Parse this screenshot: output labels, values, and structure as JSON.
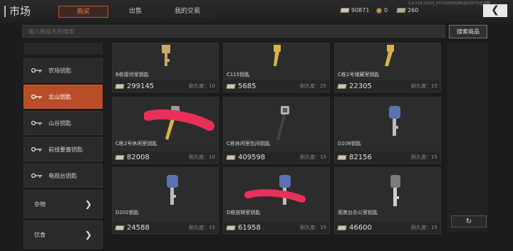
{
  "header": {
    "title": "市场",
    "tabs": [
      {
        "label": "购买",
        "active": true
      },
      {
        "label": "出售",
        "active": false
      },
      {
        "label": "我的交易",
        "active": false
      }
    ],
    "build_info": "1.0.118.11612_071|10525|3819|21073|正式服",
    "currencies": [
      {
        "icon": "cash-icon",
        "value": "90871"
      },
      {
        "icon": "coin-icon",
        "value": "0"
      },
      {
        "icon": "voucher-icon",
        "value": "260"
      }
    ],
    "back_icon": "chevron-left-icon"
  },
  "search": {
    "placeholder": "输入物品名称搜索",
    "button_label": "搜索商品"
  },
  "sidebar": {
    "items": [
      {
        "label": "农场钥匙",
        "active": false,
        "type": "key"
      },
      {
        "label": "北山钥匙",
        "active": true,
        "type": "key"
      },
      {
        "label": "山谷钥匙",
        "active": false,
        "type": "key"
      },
      {
        "label": "前线要塞钥匙",
        "active": false,
        "type": "key"
      },
      {
        "label": "电视台钥匙",
        "active": false,
        "type": "key"
      }
    ],
    "categories": [
      {
        "label": "杂物"
      },
      {
        "label": "饮食"
      }
    ]
  },
  "items": [
    {
      "name": "B栋接待室钥匙",
      "price": "299145",
      "durability": "耐久度：10",
      "key_color": "#c9a56a"
    },
    {
      "name": "C115钥匙",
      "price": "5685",
      "durability": "耐久度：25",
      "key_color": "#d9b24a"
    },
    {
      "name": "C栋2号储藏室钥匙",
      "price": "22305",
      "durability": "耐久度：15",
      "key_color": "#d9b24a"
    },
    {
      "name": "C栋2号休闲室钥匙",
      "price": "82008",
      "durability": "耐久度：10",
      "key_color": "#d9b24a"
    },
    {
      "name": "C栋休闲室包间钥匙",
      "price": "409598",
      "durability": "耐久度：15",
      "key_color": "#a8a8a8"
    },
    {
      "name": "D208钥匙",
      "price": "82156",
      "durability": "耐久度：15",
      "key_color": "#5a72b0"
    },
    {
      "name": "D202钥匙",
      "price": "24588",
      "durability": "耐久度：15",
      "key_color": "#5a72b0"
    },
    {
      "name": "D栋放映室钥匙",
      "price": "61958",
      "durability": "耐久度：15",
      "key_color": "#5a72b0"
    },
    {
      "name": "观景台办公室钥匙",
      "price": "46600",
      "durability": "耐久度：15",
      "key_color": "#7a7a7a"
    }
  ],
  "colors": {
    "accent": "#c8512a",
    "scribble": "#e8305a"
  },
  "refresh_icon": "refresh-icon"
}
